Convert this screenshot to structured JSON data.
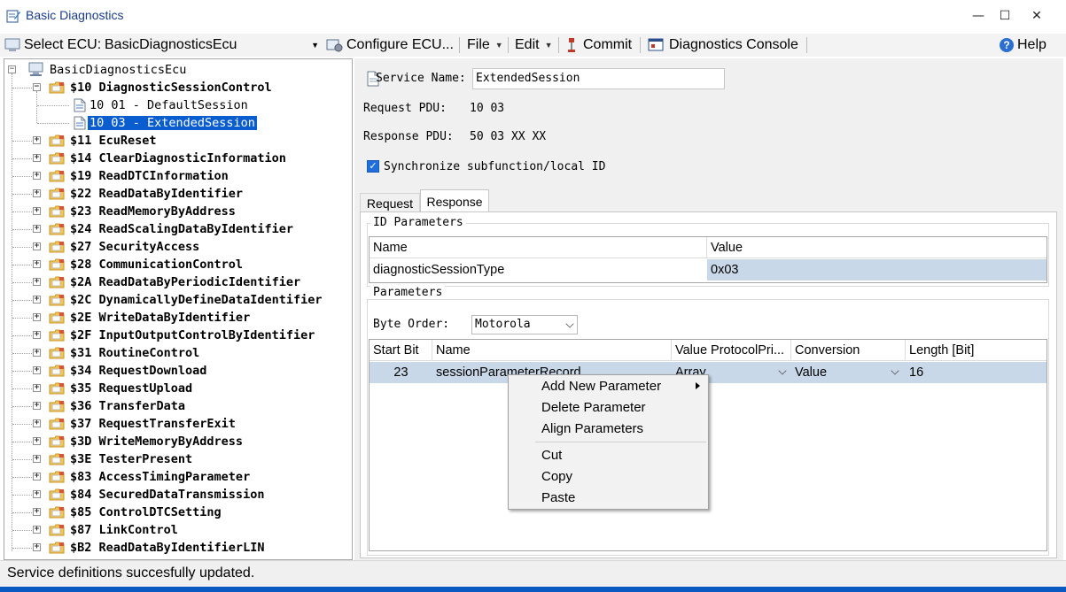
{
  "window": {
    "title": "Basic Diagnostics",
    "min_glyph": "—",
    "max_glyph": "☐",
    "close_glyph": "✕"
  },
  "toolbar": {
    "select_ecu_label": "Select ECU:",
    "selected_ecu": "BasicDiagnosticsEcu",
    "configure_label": "Configure ECU...",
    "file_label": "File",
    "edit_label": "Edit",
    "commit_label": "Commit",
    "console_label": "Diagnostics Console",
    "help_label": "Help"
  },
  "tree": {
    "root": "BasicDiagnosticsEcu",
    "expanded_service": "$10 DiagnosticSessionControl",
    "subfunctions": [
      "10 01 - DefaultSession",
      "10 03 - ExtendedSession"
    ],
    "selected_subfunction": "10 03 - ExtendedSession",
    "services": [
      "$11 EcuReset",
      "$14 ClearDiagnosticInformation",
      "$19 ReadDTCInformation",
      "$22 ReadDataByIdentifier",
      "$23 ReadMemoryByAddress",
      "$24 ReadScalingDataByIdentifier",
      "$27 SecurityAccess",
      "$28 CommunicationControl",
      "$2A ReadDataByPeriodicIdentifier",
      "$2C DynamicallyDefineDataIdentifier",
      "$2E WriteDataByIdentifier",
      "$2F InputOutputControlByIdentifier",
      "$31 RoutineControl",
      "$34 RequestDownload",
      "$35 RequestUpload",
      "$36 TransferData",
      "$37 RequestTransferExit",
      "$3D WriteMemoryByAddress",
      "$3E TesterPresent",
      "$83 AccessTimingParameter",
      "$84 SecuredDataTransmission",
      "$85 ControlDTCSetting",
      "$87 LinkControl",
      "$B2 ReadDataByIdentifierLIN"
    ]
  },
  "service": {
    "name_label": "Service Name:",
    "name_value": "ExtendedSession",
    "request_pdu_label": "Request PDU:",
    "request_pdu_value": "10 03",
    "response_pdu_label": "Response PDU:",
    "response_pdu_value": "50 03 XX XX",
    "sync_label": "Synchronize subfunction/local ID",
    "sync_checked": true
  },
  "tabs": {
    "request": "Request",
    "response": "Response",
    "active": "Response"
  },
  "id_parameters": {
    "title": "ID Parameters",
    "columns": [
      "Name",
      "Value"
    ],
    "rows": [
      {
        "name": "diagnosticSessionType",
        "value": "0x03"
      }
    ]
  },
  "parameters": {
    "title": "Parameters",
    "byte_order_label": "Byte Order:",
    "byte_order_value": "Motorola",
    "columns": [
      "Start Bit",
      "Name",
      "Value ProtocolPri...",
      "Conversion",
      "Length [Bit]"
    ],
    "rows": [
      {
        "start_bit": "23",
        "name": "sessionParameterRecord",
        "protocol": "Array",
        "conversion": "Value",
        "length": "16"
      }
    ]
  },
  "context_menu": {
    "items": [
      "Add New Parameter",
      "Delete Parameter",
      "Align Parameters",
      "Cut",
      "Copy",
      "Paste"
    ]
  },
  "status": {
    "text": "Service definitions succesfully updated."
  },
  "colors": {
    "selection": "#0a5dcf",
    "row_highlight": "#c9d8e8",
    "title_text": "#1a3b8c",
    "accent": "#1e6fd9"
  }
}
